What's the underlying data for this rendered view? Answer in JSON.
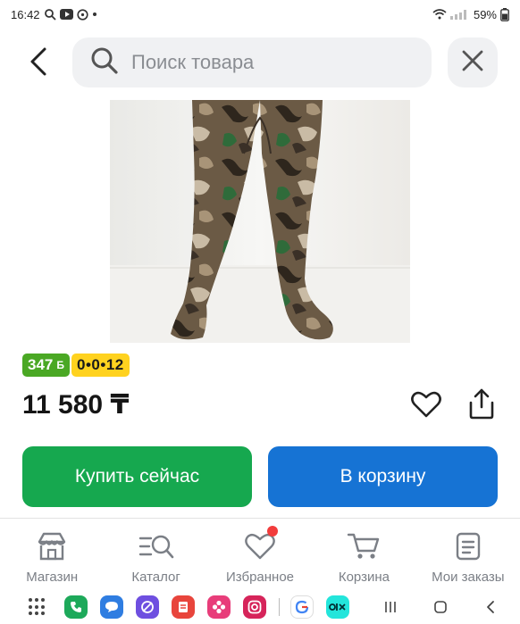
{
  "status_bar": {
    "time": "16:42",
    "battery": "59%",
    "icons": [
      "search-icon",
      "youtube-icon",
      "whatsapp-icon",
      "wifi-icon",
      "signal-icon",
      "battery-icon"
    ]
  },
  "search": {
    "placeholder": "Поиск товара",
    "value": ""
  },
  "product": {
    "image": "camouflage-waders-photo",
    "bonus": "347",
    "bonus_sup": "Б",
    "installment": "0•0•12",
    "price": "11 580 ₸"
  },
  "actions": {
    "buy_now": "Купить сейчас",
    "add_to_cart": "В корзину"
  },
  "bottom_nav": {
    "items": [
      {
        "label": "Магазин",
        "icon": "shop-icon"
      },
      {
        "label": "Каталог",
        "icon": "catalog-search-icon"
      },
      {
        "label": "Избранное",
        "icon": "heart-icon"
      },
      {
        "label": "Корзина",
        "icon": "cart-icon"
      },
      {
        "label": "Мои заказы",
        "icon": "orders-icon"
      }
    ]
  },
  "colors": {
    "buy": "#16a84f",
    "cart": "#1673d4",
    "bonus_badge": "#4aa824",
    "installment_badge": "#ffd21f",
    "notification": "#f23c3c"
  }
}
